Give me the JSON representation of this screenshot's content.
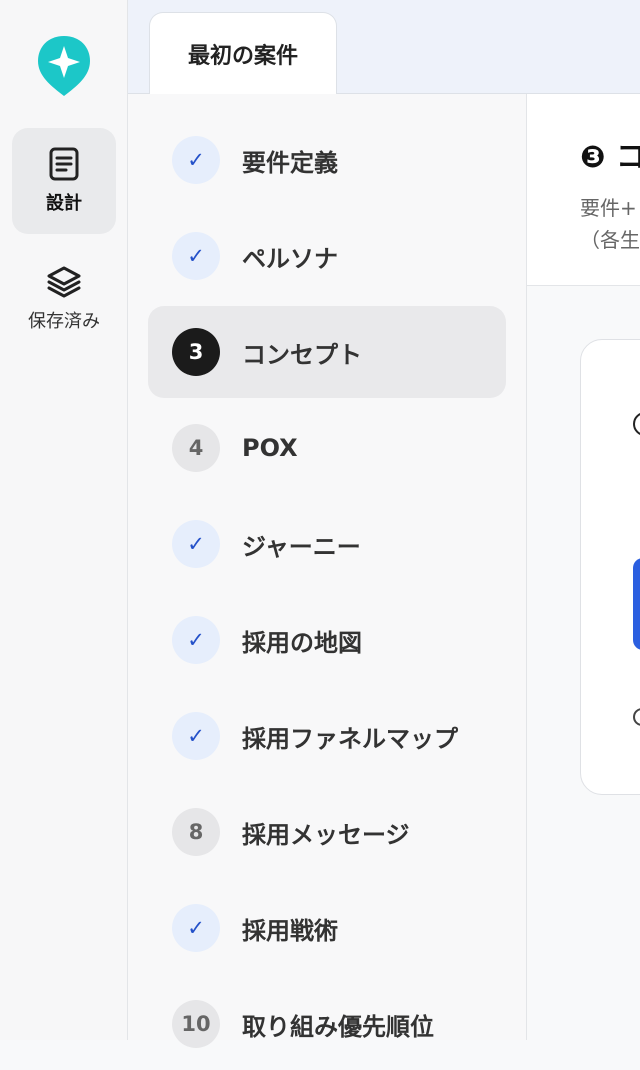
{
  "sidebar": {
    "items": [
      {
        "label": "設計",
        "icon": "document-icon",
        "active": true
      },
      {
        "label": "保存済み",
        "icon": "layers-icon",
        "active": false
      }
    ]
  },
  "tabs": [
    {
      "label": "最初の案件"
    }
  ],
  "steps": [
    {
      "label": "要件定義",
      "status": "done",
      "badge": "✓"
    },
    {
      "label": "ペルソナ",
      "status": "done",
      "badge": "✓"
    },
    {
      "label": "コンセプト",
      "status": "current",
      "badge": "3"
    },
    {
      "label": "POX",
      "status": "todo",
      "badge": "4"
    },
    {
      "label": "ジャーニー",
      "status": "done",
      "badge": "✓"
    },
    {
      "label": "採用の地図",
      "status": "done",
      "badge": "✓"
    },
    {
      "label": "採用ファネルマップ",
      "status": "done",
      "badge": "✓"
    },
    {
      "label": "採用メッセージ",
      "status": "todo",
      "badge": "8"
    },
    {
      "label": "採用戦術",
      "status": "done",
      "badge": "✓"
    },
    {
      "label": "取り組み優先順位",
      "status": "todo",
      "badge": "10"
    }
  ],
  "main": {
    "title": "❸ コ",
    "desc_line1": "要件+",
    "desc_line2": "（各生"
  },
  "colors": {
    "accent": "#2451c9",
    "logo": "#1cc7c8",
    "current_badge": "#1b1b1b"
  }
}
